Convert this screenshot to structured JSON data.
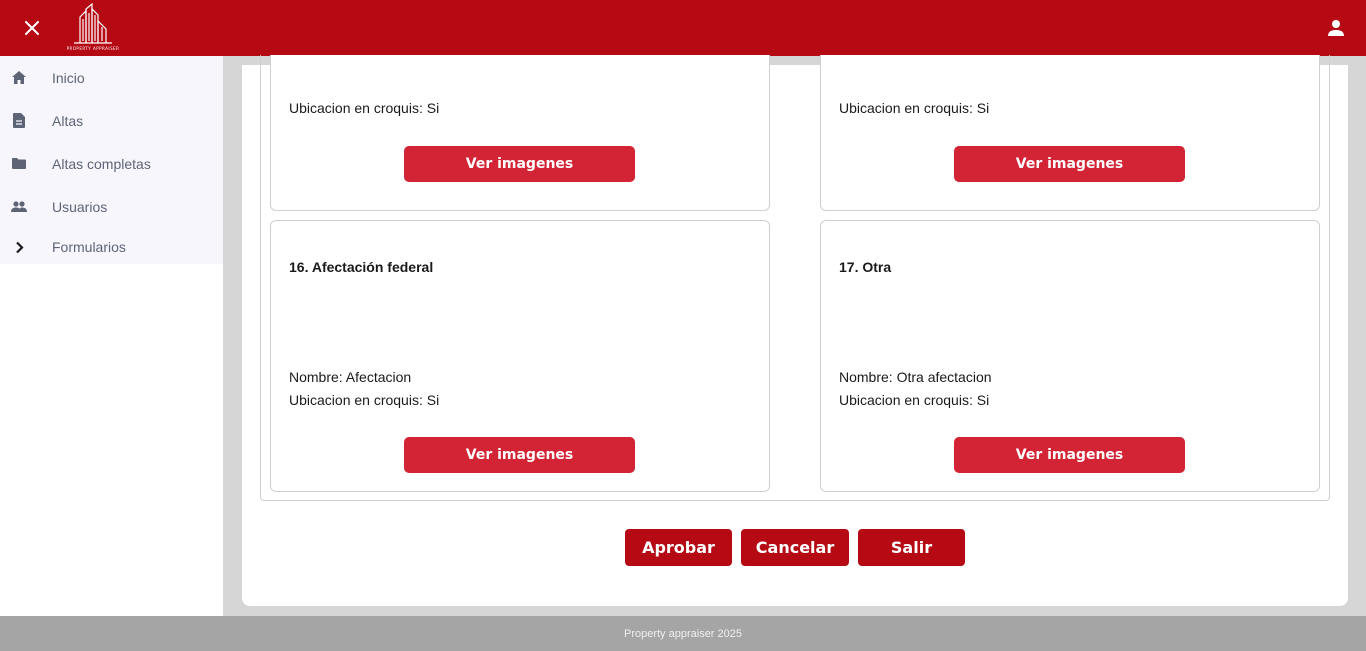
{
  "header": {
    "logo_text": "PROPERTY APPRAISER",
    "close_icon": "close-icon",
    "user_icon": "person-icon",
    "brand_color": "#b50a13"
  },
  "sidebar": {
    "items": [
      {
        "label": "Inicio",
        "icon": "home-icon"
      },
      {
        "label": "Altas",
        "icon": "document-icon"
      },
      {
        "label": "Altas completas",
        "icon": "label-icon"
      },
      {
        "label": "Usuarios",
        "icon": "people-icon"
      },
      {
        "label": "Formularios",
        "icon": "chevron-right-icon"
      }
    ]
  },
  "cards": [
    {
      "title": "",
      "lines": [
        "Ubicacion en croquis: Si"
      ],
      "button": "Ver imagenes"
    },
    {
      "title": "",
      "lines": [
        "Ubicacion en croquis: Si"
      ],
      "button": "Ver imagenes"
    },
    {
      "title": "16. Afectación federal",
      "lines": [
        "Nombre: Afectacion",
        "Ubicacion en croquis: Si"
      ],
      "button": "Ver imagenes"
    },
    {
      "title": "17. Otra",
      "lines": [
        "Nombre: Otra afectacion",
        "Ubicacion en croquis: Si"
      ],
      "button": "Ver imagenes"
    }
  ],
  "actions": {
    "approve": "Aprobar",
    "cancel": "Cancelar",
    "exit": "Salir"
  },
  "footer": {
    "text": "Property appraiser 2025"
  }
}
